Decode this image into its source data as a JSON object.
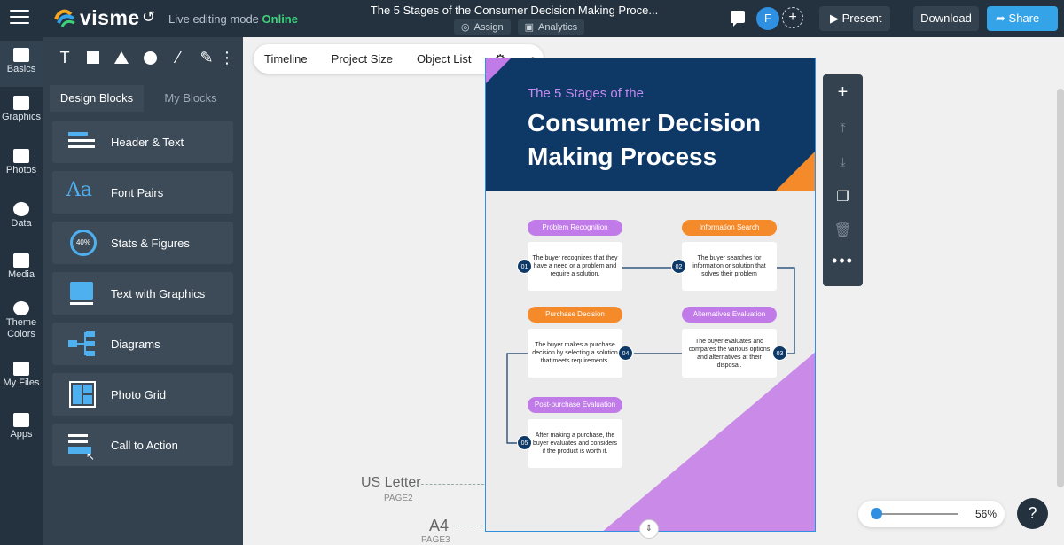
{
  "app": {
    "brand": "visme",
    "mode_prefix": "Live editing mode",
    "mode_status": "Online",
    "doc_title": "The 5 Stages of the Consumer Decision Making Proce...",
    "assign_label": "Assign",
    "analytics_label": "Analytics",
    "avatar_initial": "F",
    "present_label": "Present",
    "download_label": "Download",
    "share_label": "Share"
  },
  "rail": {
    "items": [
      {
        "label": "Basics"
      },
      {
        "label": "Graphics"
      },
      {
        "label": "Photos"
      },
      {
        "label": "Data"
      },
      {
        "label": "Media"
      },
      {
        "label": "Theme Colors"
      },
      {
        "label": "My Files"
      },
      {
        "label": "Apps"
      }
    ]
  },
  "panel": {
    "tools": [
      "T"
    ],
    "tabs": [
      "Design Blocks",
      "My Blocks"
    ],
    "blocks": [
      {
        "label": "Header & Text"
      },
      {
        "label": "Font Pairs"
      },
      {
        "label": "Stats & Figures",
        "badge": "40%"
      },
      {
        "label": "Text with Graphics"
      },
      {
        "label": "Diagrams"
      },
      {
        "label": "Photo Grid"
      },
      {
        "label": "Call to Action"
      }
    ]
  },
  "canvas_toolbar": {
    "timeline": "Timeline",
    "project_size": "Project Size",
    "object_list": "Object List"
  },
  "pages": {
    "us_letter": "US Letter",
    "us_letter_sub": "PAGE2",
    "a4": "A4",
    "a4_sub": "PAGE3"
  },
  "infographic": {
    "kicker": "The 5 Stages of the",
    "title": "Consumer Decision Making Process",
    "stages": [
      {
        "num": "01",
        "name": "Problem Recognition",
        "text": "The buyer recognizes that they have a need or a problem and require a solution.",
        "color": "#c07be8"
      },
      {
        "num": "02",
        "name": "Information Search",
        "text": "The buyer searches for information or solution that solves their problem",
        "color": "#f58a2a"
      },
      {
        "num": "03",
        "name": "Alternatives Evaluation",
        "text": "The buyer evaluates and compares the various options and alternatives at their disposal.",
        "color": "#c07be8"
      },
      {
        "num": "04",
        "name": "Purchase Decision",
        "text": "The buyer makes a purchase decision by selecting a solution that meets requirements.",
        "color": "#f58a2a"
      },
      {
        "num": "05",
        "name": "Post-purchase Evaluation",
        "text": "After making a purchase, the buyer evaluates and considers if the product is worth it.",
        "color": "#c07be8"
      }
    ]
  },
  "zoom": {
    "value": "56%"
  },
  "help": "?",
  "colors": {
    "topbar": "#24323f",
    "accent": "#34a3e8",
    "online": "#3ed07a",
    "navy": "#0e3866",
    "purple": "#c07be8",
    "orange": "#f58a2a"
  }
}
